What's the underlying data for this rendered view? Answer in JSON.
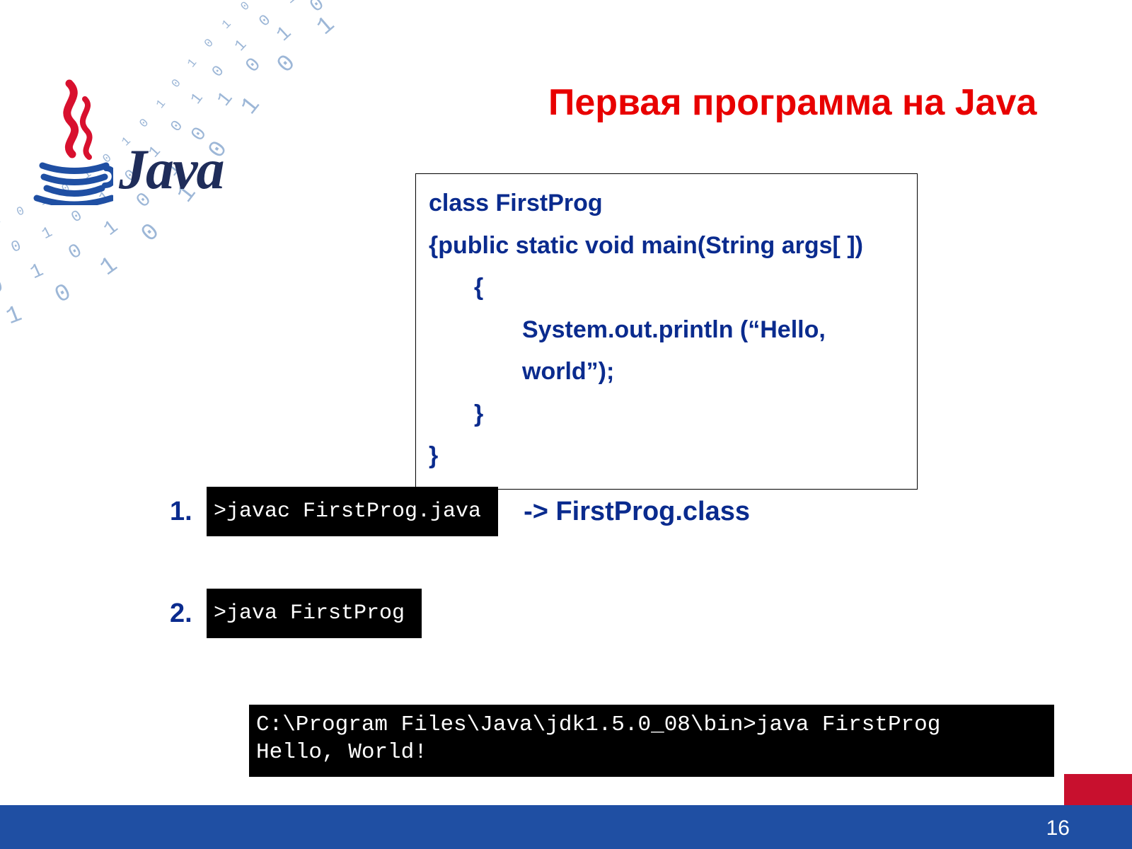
{
  "logo_word": "Java",
  "title": "Первая программа на Java",
  "code": {
    "l1": "class FirstProg",
    "l2": "{public static void main(String args[ ])",
    "l3": "{",
    "l4": "System.out.println (“Hello, world”);",
    "l5": "}",
    "l6": "}"
  },
  "steps": [
    {
      "num": "1.",
      "cmd": ">javac FirstProg.java",
      "result": "-> FirstProg.class"
    },
    {
      "num": "2.",
      "cmd": ">java FirstProg"
    }
  ],
  "output": "C:\\Program Files\\Java\\jdk1.5.0_08\\bin>java FirstProg\nHello, World!",
  "page_number": "16"
}
